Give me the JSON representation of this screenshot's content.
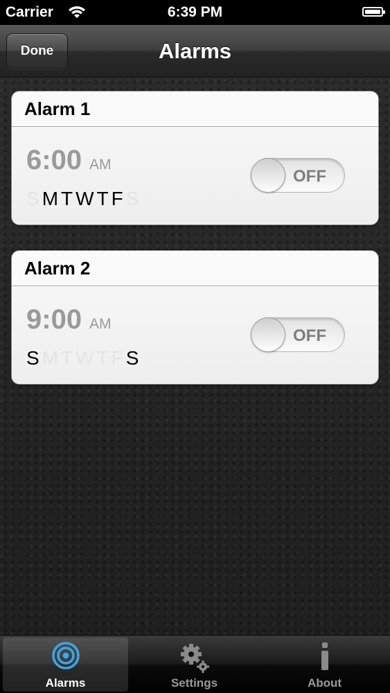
{
  "status_bar": {
    "carrier": "Carrier",
    "time": "6:39 PM"
  },
  "nav": {
    "done_label": "Done",
    "title": "Alarms"
  },
  "alarms": [
    {
      "name": "Alarm 1",
      "time": "6:00",
      "ampm": "AM",
      "toggle": "OFF",
      "days": [
        {
          "letter": "S",
          "active": false
        },
        {
          "letter": "M",
          "active": true
        },
        {
          "letter": "T",
          "active": true
        },
        {
          "letter": "W",
          "active": true
        },
        {
          "letter": "T",
          "active": true
        },
        {
          "letter": "F",
          "active": true
        },
        {
          "letter": "S",
          "active": false
        }
      ]
    },
    {
      "name": "Alarm 2",
      "time": "9:00",
      "ampm": "AM",
      "toggle": "OFF",
      "days": [
        {
          "letter": "S",
          "active": true
        },
        {
          "letter": "M",
          "active": false
        },
        {
          "letter": "T",
          "active": false
        },
        {
          "letter": "W",
          "active": false
        },
        {
          "letter": "T",
          "active": false
        },
        {
          "letter": "F",
          "active": false
        },
        {
          "letter": "S",
          "active": true
        }
      ]
    }
  ],
  "tabs": [
    {
      "label": "Alarms",
      "icon": "target-icon",
      "selected": true
    },
    {
      "label": "Settings",
      "icon": "gears-icon",
      "selected": false
    },
    {
      "label": "About",
      "icon": "info-icon",
      "selected": false
    }
  ],
  "colors": {
    "accent_blue": "#3aa7e8",
    "card_bg": "#f2f2f2",
    "inactive_text": "#9b9b9b"
  }
}
